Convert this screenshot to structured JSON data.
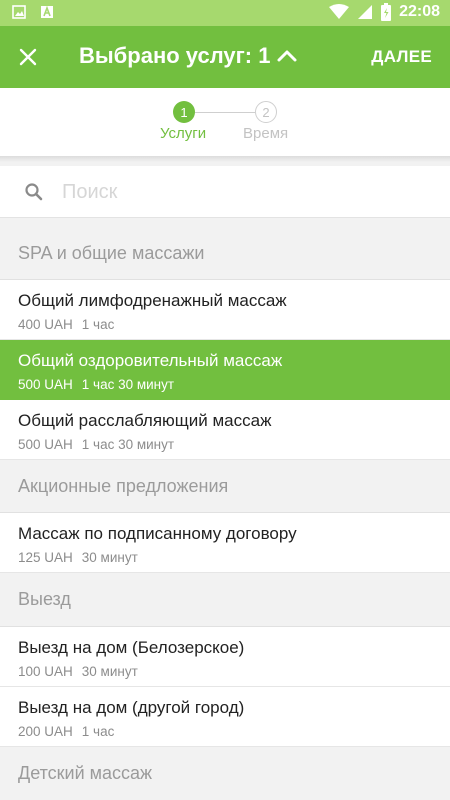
{
  "status_bar": {
    "time": "22:08",
    "left_icons": [
      "image-icon",
      "app-icon"
    ],
    "right_icons": [
      "wifi-icon",
      "signal-icon",
      "battery-icon"
    ]
  },
  "header": {
    "title": "Выбрано услуг: 1",
    "next_label": "ДАЛЕЕ",
    "accent": "#72bf3f",
    "status_color": "#a6d96e"
  },
  "stepper": {
    "steps": [
      {
        "number": "1",
        "label": "Услуги",
        "active": true
      },
      {
        "number": "2",
        "label": "Время",
        "active": false
      }
    ]
  },
  "search": {
    "placeholder": "Поиск",
    "value": ""
  },
  "sections": [
    {
      "title": "SPA и общие массажи",
      "services": [
        {
          "name": "Общий лимфодренажный массаж",
          "price": "400 UAH",
          "duration": "1 час",
          "selected": false
        },
        {
          "name": "Общий оздоровительный массаж",
          "price": "500 UAH",
          "duration": "1 час 30 минут",
          "selected": true
        },
        {
          "name": "Общий расслабляющий массаж",
          "price": "500 UAH",
          "duration": "1 час 30 минут",
          "selected": false
        }
      ]
    },
    {
      "title": "Акционные предложения",
      "services": [
        {
          "name": "Массаж по подписанному договору",
          "price": "125 UAH",
          "duration": "30 минут",
          "selected": false
        }
      ]
    },
    {
      "title": "Выезд",
      "services": [
        {
          "name": "Выезд на дом (Белозерское)",
          "price": "100 UAH",
          "duration": "30 минут",
          "selected": false
        },
        {
          "name": "Выезд на дом (другой город)",
          "price": "200 UAH",
          "duration": "1 час",
          "selected": false
        }
      ]
    },
    {
      "title": "Детский массаж",
      "services": []
    }
  ]
}
